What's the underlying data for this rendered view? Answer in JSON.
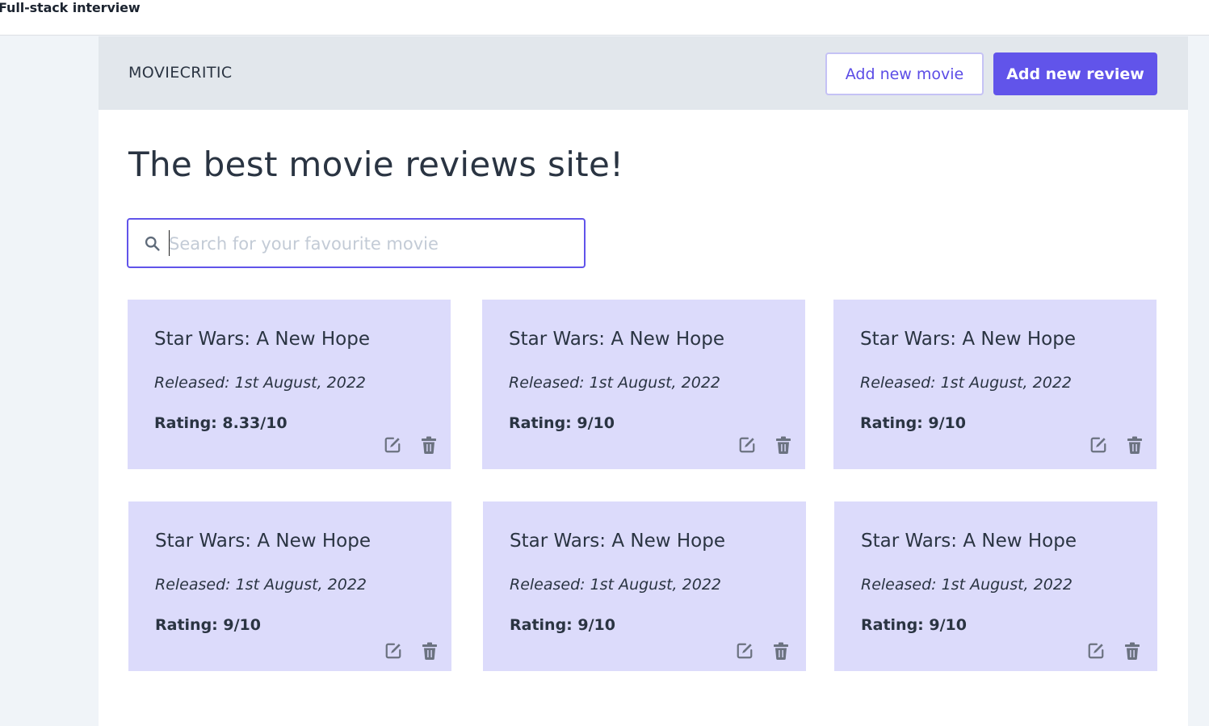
{
  "window": {
    "title": "Full-stack interview"
  },
  "navbar": {
    "brand": "MOVIECRITIC",
    "add_movie_label": "Add new movie",
    "add_review_label": "Add new review"
  },
  "main": {
    "heading": "The best movie reviews site!",
    "search": {
      "placeholder": "Search for your favourite movie",
      "value": ""
    }
  },
  "colors": {
    "accent": "#6154ea",
    "card_bg": "#dcdbfb",
    "navbar_bg": "#e2e7ec"
  },
  "movies": [
    {
      "title": "Star Wars: A New Hope",
      "released": "Released: 1st August, 2022",
      "rating": "Rating: 8.33/10"
    },
    {
      "title": "Star Wars: A New Hope",
      "released": "Released: 1st August, 2022",
      "rating": "Rating: 9/10"
    },
    {
      "title": "Star Wars: A New Hope",
      "released": "Released: 1st August, 2022",
      "rating": "Rating: 9/10"
    },
    {
      "title": "Star Wars: A New Hope",
      "released": "Released: 1st August, 2022",
      "rating": "Rating: 9/10"
    },
    {
      "title": "Star Wars: A New Hope",
      "released": "Released: 1st August, 2022",
      "rating": "Rating: 9/10"
    },
    {
      "title": "Star Wars: A New Hope",
      "released": "Released: 1st August, 2022",
      "rating": "Rating: 9/10"
    }
  ],
  "card_icons": {
    "edit": "edit-icon",
    "delete": "trash-icon"
  }
}
